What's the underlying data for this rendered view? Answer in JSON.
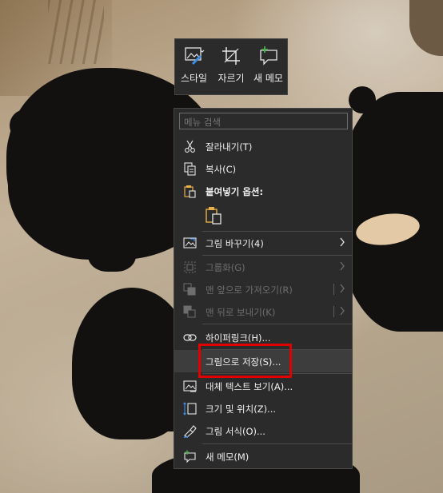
{
  "minibar": {
    "style_label": "스타일",
    "crop_label": "자르기",
    "note_label": "새 메모"
  },
  "menu": {
    "search_placeholder": "메뉴 검색",
    "cut": "잘라내기(T)",
    "copy": "복사(C)",
    "paste_options": "붙여넣기 옵션:",
    "change_picture": "그림 바꾸기(4)",
    "group": "그룹화(G)",
    "bring_to_front": "맨 앞으로 가져오기(R)",
    "send_to_back": "맨 뒤로 보내기(K)",
    "hyperlink": "하이퍼링크(H)...",
    "save_as_picture": "그림으로 저장(S)...",
    "alt_text": "대체 텍스트 보기(A)...",
    "size_position": "크기 및 위치(Z)...",
    "format_picture": "그림 서식(O)...",
    "new_note": "새 메모(M)"
  },
  "colors": {
    "menu_bg": "#2b2b2b",
    "text": "#f0f0f0",
    "disabled_text": "#6e6e6e",
    "highlight_box": "#e00000",
    "accent_green": "#4caf50"
  }
}
